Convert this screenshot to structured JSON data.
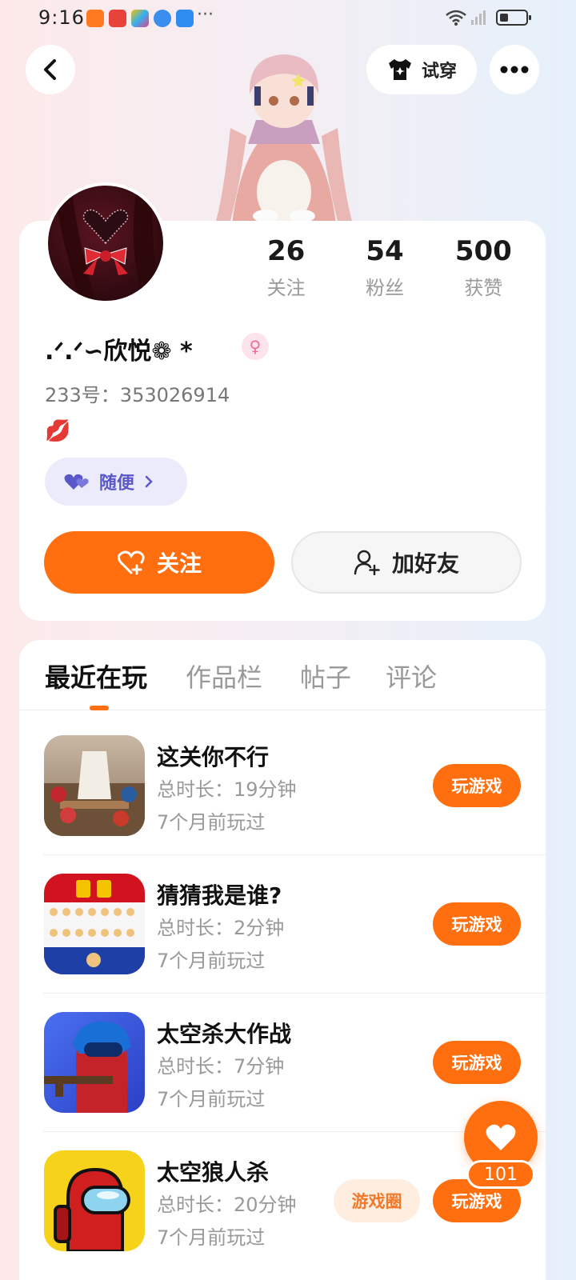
{
  "status_bar": {
    "time": "9:16",
    "more": "···"
  },
  "header": {
    "tryon_label": "试穿"
  },
  "profile": {
    "stats": [
      {
        "value": "26",
        "label": "关注"
      },
      {
        "value": "54",
        "label": "粉丝"
      },
      {
        "value": "500",
        "label": "获赞"
      }
    ],
    "username": ".ᐟ.ᐟ∽欣悦❁ *",
    "gender_symbol": "♀",
    "user_id": "233号：353026914",
    "lips": "💋",
    "mood_label": "随便",
    "follow_label": "关注",
    "add_friend_label": "加好友"
  },
  "tabs": [
    "最近在玩",
    "作品栏",
    "帖子",
    "评论"
  ],
  "games": [
    {
      "title": "这关你不行",
      "duration": "总时长：19分钟",
      "last_played": "7个月前玩过",
      "play_label": "玩游戏"
    },
    {
      "title": "猜猜我是谁?",
      "duration": "总时长：2分钟",
      "last_played": "7个月前玩过",
      "play_label": "玩游戏"
    },
    {
      "title": "太空杀大作战",
      "duration": "总时长：7分钟",
      "last_played": "7个月前玩过",
      "play_label": "玩游戏"
    },
    {
      "title": "太空狼人杀",
      "duration": "总时长：20分钟",
      "last_played": "7个月前玩过",
      "play_label": "玩游戏",
      "circle_label": "游戏圈"
    }
  ],
  "like": {
    "count": "101"
  },
  "colors": {
    "accent": "#ff6f0f",
    "mood": "#5a58c8"
  }
}
